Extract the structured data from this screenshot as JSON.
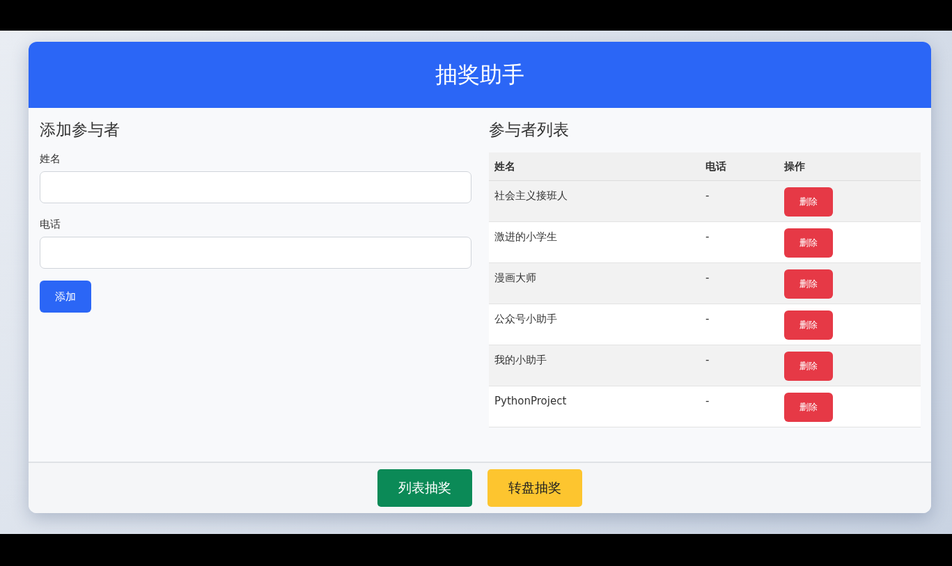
{
  "header": {
    "title": "抽奖助手"
  },
  "form": {
    "title": "添加参与者",
    "fields": [
      {
        "label": "姓名"
      },
      {
        "label": "电话"
      }
    ],
    "submit": "添加"
  },
  "list": {
    "title": "参与者列表",
    "columns": [
      "姓名",
      "电话",
      "操作"
    ],
    "rows": [
      {
        "name": "社会主义接班人",
        "phone": "-",
        "action": "删除"
      },
      {
        "name": "激进的小学生",
        "phone": "-",
        "action": "删除"
      },
      {
        "name": "漫画大师",
        "phone": "-",
        "action": "删除"
      },
      {
        "name": "公众号小助手",
        "phone": "-",
        "action": "删除"
      },
      {
        "name": "我的小助手",
        "phone": "-",
        "action": "删除"
      },
      {
        "name": "PythonProject",
        "phone": "-",
        "action": "删除"
      }
    ]
  },
  "footer": {
    "buttons": [
      {
        "label": "列表抽奖",
        "kind": "primary"
      },
      {
        "label": "转盘抽奖",
        "kind": "secondary"
      }
    ]
  }
}
